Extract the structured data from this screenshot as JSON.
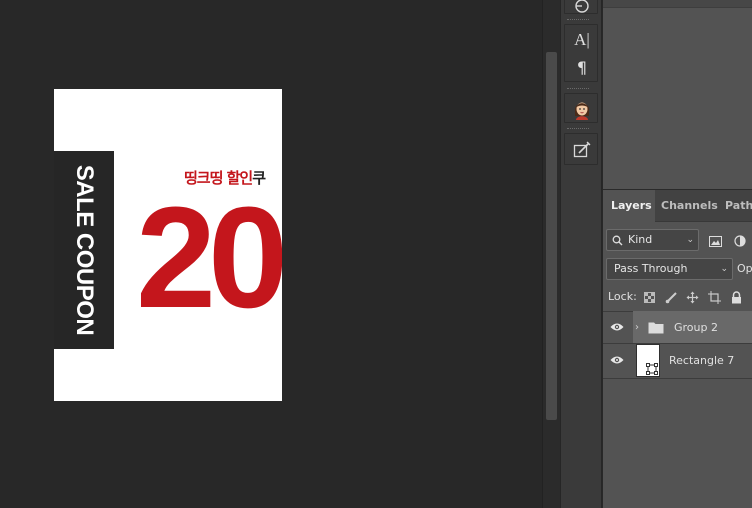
{
  "document": {
    "vertical_text": "SALE COUPON",
    "promo_red": "띵크띵 할인",
    "promo_dark": "쿠",
    "big_number": "20"
  },
  "tools": [
    {
      "name": "3d-rotate-icon"
    },
    {
      "name": "character-icon",
      "glyph": "A|"
    },
    {
      "name": "paragraph-icon",
      "glyph": "¶"
    },
    {
      "name": "avatar-icon"
    },
    {
      "name": "note-edit-icon"
    }
  ],
  "layers_panel": {
    "tabs": [
      "Layers",
      "Channels",
      "Paths"
    ],
    "active_tab": "Layers",
    "filter_kind": "Kind",
    "blend_mode": "Pass Through",
    "opacity_label": "Op",
    "lock_label": "Lock:",
    "layers": [
      {
        "name": "Group 2",
        "type": "group",
        "visible": true,
        "selected": true
      },
      {
        "name": "Rectangle 7",
        "type": "shape",
        "visible": true,
        "selected": false
      }
    ]
  },
  "colors": {
    "accent_red": "#c4161c",
    "band_dark": "#262626",
    "canvas_bg": "#282828",
    "panel_bg": "#535353"
  }
}
